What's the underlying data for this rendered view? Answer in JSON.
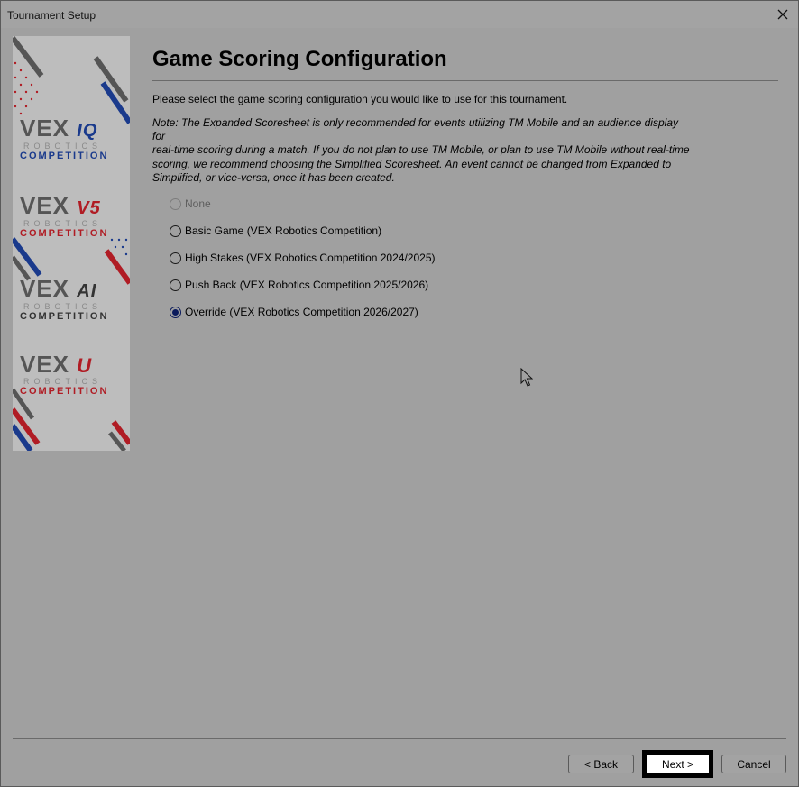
{
  "window": {
    "title": "Tournament Setup"
  },
  "page": {
    "heading": "Game Scoring Configuration",
    "intro": "Please select the game scoring configuration you would like to use for this tournament.",
    "note_lines": [
      "Note: The Expanded Scoresheet is only recommended for events utilizing TM Mobile and an audience display for",
      "real-time scoring during a match.  If you do not plan to use TM Mobile, or plan to use TM Mobile without real-time",
      "scoring, we recommend choosing the Simplified Scoresheet.  An event cannot be changed from Expanded to",
      "Simplified, or vice-versa, once it has been created."
    ]
  },
  "options": [
    {
      "label": "None",
      "enabled": false,
      "selected": false
    },
    {
      "label": "Basic Game (VEX Robotics Competition)",
      "enabled": true,
      "selected": false
    },
    {
      "label": "High Stakes (VEX Robotics Competition 2024/2025)",
      "enabled": true,
      "selected": false
    },
    {
      "label": "Push Back (VEX Robotics Competition 2025/2026)",
      "enabled": true,
      "selected": false
    },
    {
      "label": "Override (VEX Robotics Competition 2026/2027)",
      "enabled": true,
      "selected": true
    }
  ],
  "banner": {
    "logos": [
      {
        "name": "VEX",
        "suffix": "IQ",
        "sub": "ROBOTICS",
        "comp": "COMPETITION",
        "accent": "#1a3a8c"
      },
      {
        "name": "VEX",
        "suffix": "V5",
        "sub": "ROBOTICS",
        "comp": "COMPETITION",
        "accent": "#b01c24"
      },
      {
        "name": "VEX",
        "suffix": "AI",
        "sub": "ROBOTICS",
        "comp": "COMPETITION",
        "accent": "#333333"
      },
      {
        "name": "VEX",
        "suffix": "U",
        "sub": "ROBOTICS",
        "comp": "COMPETITION",
        "accent": "#b01c24"
      }
    ]
  },
  "buttons": {
    "back": "< Back",
    "next": "Next >",
    "cancel": "Cancel"
  }
}
